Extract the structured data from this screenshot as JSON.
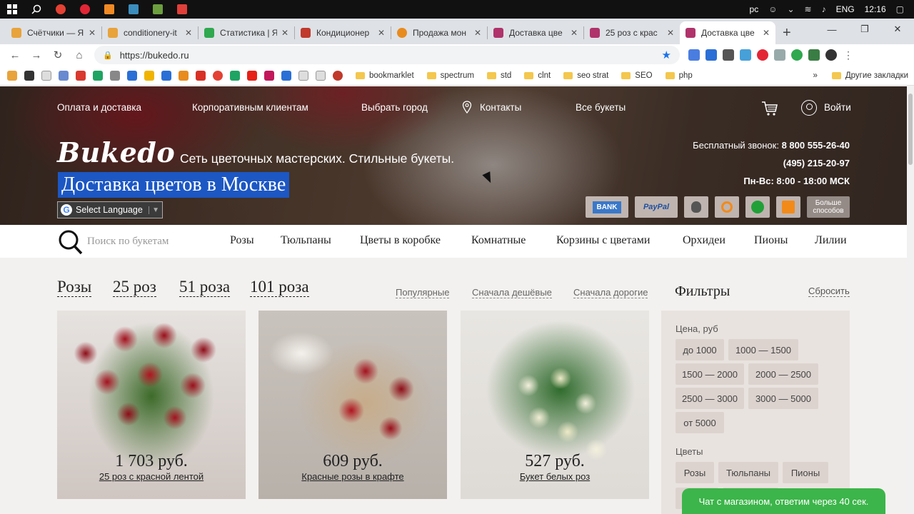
{
  "taskbar": {
    "lang_short": "рс",
    "lang": "ENG",
    "time": "12:16"
  },
  "tabs": [
    {
      "title": "Счётчики — Я",
      "color": "#e8a33b"
    },
    {
      "title": "conditionery-it",
      "color": "#e8a33b"
    },
    {
      "title": "Статистика | Я",
      "color": "#2fa84f"
    },
    {
      "title": "Кондиционер",
      "color": "#c0392b"
    },
    {
      "title": "Продажа мон",
      "color": "#e88b1e"
    },
    {
      "title": "Доставка цве",
      "color": "#b0336b"
    },
    {
      "title": "25 роз с крас",
      "color": "#b0336b"
    },
    {
      "title": "Доставка цве",
      "color": "#b0336b",
      "active": true
    }
  ],
  "omnibox": {
    "url": "https://bukedo.ru"
  },
  "bookmarks": {
    "folders": [
      "bookmarklet",
      "spectrum",
      "std",
      "clnt",
      "seo strat",
      "SEO",
      "php"
    ],
    "other": "Другие закладки",
    "more": "»"
  },
  "site": {
    "nav": {
      "payment": "Оплата и доставка",
      "corporate": "Корпоративным клиентам",
      "city": "Выбрать город",
      "contacts": "Контакты",
      "all": "Все букеты",
      "login": "Войти"
    },
    "logo": "Bukedo",
    "tagline": "Сеть цветочных мастерских. Стильные букеты.",
    "headline": "Доставка цветов в Москве",
    "language": "Select Language",
    "phone_free_label": "Бесплатный звонок:",
    "phone_free": "8 800 555-26-40",
    "phone": "(495) 215-20-97",
    "hours": "Пн-Вс: 8:00 - 18:00 МСК",
    "payments": {
      "bank": "BANK",
      "paypal": "PayPal",
      "more": "Больше способов"
    },
    "search_placeholder": "Поиск по букетам",
    "categories": [
      "Розы",
      "Тюльпаны",
      "Цветы в коробке",
      "Комнатные",
      "Корзины с цветами",
      "Орхидеи",
      "Пионы",
      "Лилии"
    ],
    "subtabs": [
      "Розы",
      "25 роз",
      "51 роза",
      "101 роза"
    ],
    "sorts": [
      "Популярные",
      "Сначала дешёвые",
      "Сначала дорогие"
    ],
    "products": [
      {
        "price": "1 703 руб.",
        "name": "25 роз с красной лентой"
      },
      {
        "price": "609 руб.",
        "name": "Красные розы в крафте"
      },
      {
        "price": "527 руб.",
        "name": "Букет белых роз"
      }
    ],
    "filters": {
      "title": "Фильтры",
      "reset": "Сбросить",
      "price_label": "Цена, руб",
      "prices": [
        "до 1000",
        "1000 — 1500",
        "1500 — 2000",
        "2000 — 2500",
        "2500 — 3000",
        "3000 — 5000",
        "от 5000"
      ],
      "flowers_label": "Цветы",
      "flowers": [
        "Розы",
        "Тюльпаны",
        "Пионы"
      ]
    },
    "chat": "Чат с магазином, ответим через 40 сек."
  }
}
